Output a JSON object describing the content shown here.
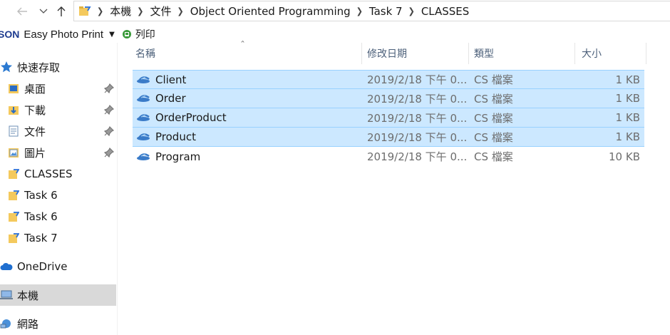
{
  "address": {
    "crumbs": [
      "本機",
      "文件",
      "Object Oriented Programming",
      "Task 7",
      "CLASSES"
    ]
  },
  "toolbar": {
    "brand": "SON",
    "app_label": "Easy Photo Print",
    "print_label": "列印"
  },
  "sidebar": {
    "items": [
      {
        "label": "快速存取"
      },
      {
        "label": "桌面"
      },
      {
        "label": "下載"
      },
      {
        "label": "文件"
      },
      {
        "label": "圖片"
      },
      {
        "label": "CLASSES"
      },
      {
        "label": "Task 6"
      },
      {
        "label": "Task 6"
      },
      {
        "label": "Task 7"
      },
      {
        "label": "OneDrive"
      },
      {
        "label": "本機"
      },
      {
        "label": "網路"
      }
    ]
  },
  "columns": {
    "name": "名稱",
    "date": "修改日期",
    "type": "類型",
    "size": "大小"
  },
  "files": [
    {
      "name": "Client",
      "date": "2019/2/18 下午 0...",
      "type": "CS 檔案",
      "size": "1 KB"
    },
    {
      "name": "Order",
      "date": "2019/2/18 下午 0...",
      "type": "CS 檔案",
      "size": "1 KB"
    },
    {
      "name": "OrderProduct",
      "date": "2019/2/18 下午 0...",
      "type": "CS 檔案",
      "size": "1 KB"
    },
    {
      "name": "Product",
      "date": "2019/2/18 下午 0...",
      "type": "CS 檔案",
      "size": "1 KB"
    },
    {
      "name": "Program",
      "date": "2019/2/18 下午 0...",
      "type": "CS 檔案",
      "size": "10 KB"
    }
  ],
  "colors": {
    "selection_bg": "#cce8ff",
    "selection_border": "#99d1ff",
    "nav_selected_bg": "#d9d9d9",
    "header_text": "#4c607a"
  }
}
